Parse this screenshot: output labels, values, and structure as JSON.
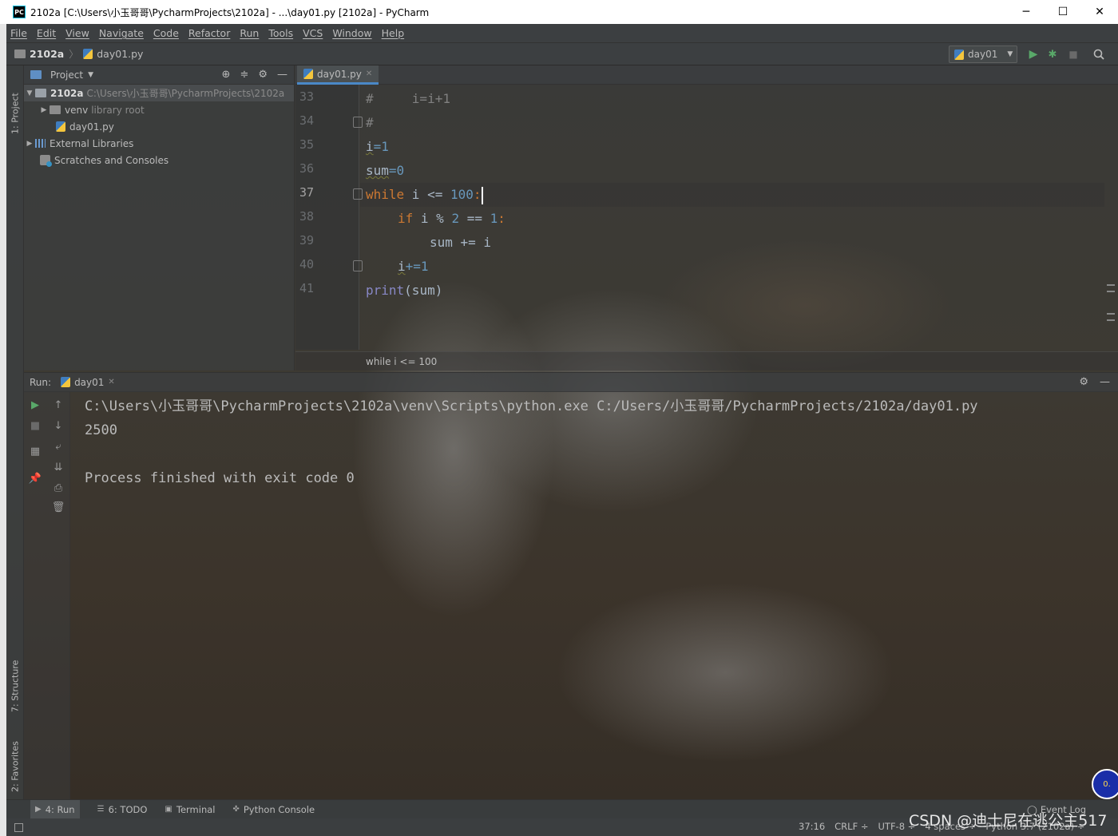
{
  "window": {
    "title": "2102a [C:\\Users\\小玉哥哥\\PycharmProjects\\2102a] - ...\\day01.py [2102a] - PyCharm",
    "app_icon_text": "PC",
    "minimize": "─",
    "maximize": "☐",
    "close": "✕"
  },
  "menu": [
    "File",
    "Edit",
    "View",
    "Navigate",
    "Code",
    "Refactor",
    "Run",
    "Tools",
    "VCS",
    "Window",
    "Help"
  ],
  "navbar": {
    "project": "2102a",
    "file": "day01.py",
    "run_config": "day01"
  },
  "left_strip": {
    "project_tab": "1: Project",
    "structure_tab": "7: Structure",
    "favorites_tab": "2: Favorites"
  },
  "project_panel": {
    "header": "Project",
    "tree": [
      {
        "label": "2102a",
        "detail": "C:\\Users\\小玉哥哥\\PycharmProjects\\2102a"
      },
      {
        "label": "venv",
        "detail": "library root"
      },
      {
        "label": "day01.py",
        "detail": ""
      },
      {
        "label": "External Libraries",
        "detail": ""
      },
      {
        "label": "Scratches and Consoles",
        "detail": ""
      }
    ]
  },
  "editor": {
    "tab": "day01.py",
    "line_numbers": [
      "33",
      "34",
      "35",
      "36",
      "37",
      "38",
      "39",
      "40",
      "41"
    ],
    "current_line": "37",
    "code": {
      "l33": "#     i=i+1",
      "l34": "#",
      "l35_var": "i",
      "l35_rest": "=1",
      "l36_var": "sum",
      "l36_rest": "=0",
      "l37_kw": "while",
      "l37_rest": " i <= ",
      "l37_num": "100",
      "l37_end": ":",
      "l38_kw": "if",
      "l38_a": " i % ",
      "l38_n1": "2",
      "l38_b": " == ",
      "l38_n2": "1",
      "l38_end": ":",
      "l39": "sum += i",
      "l40_var": "i",
      "l40_rest": "+=1",
      "l41_fn": "print",
      "l41_rest": "(sum)"
    },
    "breadcrumb": "while i <= 100"
  },
  "run_panel": {
    "label": "Run:",
    "tab": "day01",
    "console": [
      "C:\\Users\\小玉哥哥\\PycharmProjects\\2102a\\venv\\Scripts\\python.exe C:/Users/小玉哥哥/PycharmProjects/2102a/day01.py",
      "2500",
      "",
      "Process finished with exit code 0"
    ]
  },
  "bottom_tabs": [
    {
      "label": "4: Run",
      "icon": "run-icon"
    },
    {
      "label": "6: TODO",
      "icon": "todo-icon"
    },
    {
      "label": "Terminal",
      "icon": "terminal-icon"
    },
    {
      "label": "Python Console",
      "icon": "python-console-icon"
    }
  ],
  "event_log": "Event Log",
  "status": {
    "position": "37:16",
    "line_sep": "CRLF ÷",
    "encoding": "UTF-8 ÷",
    "indent": "4 spaces ÷",
    "interpreter": "Python 3.7 (2102a) ÷"
  },
  "watermark": "CSDN @迪士尼在逃公主517",
  "badge": "0."
}
